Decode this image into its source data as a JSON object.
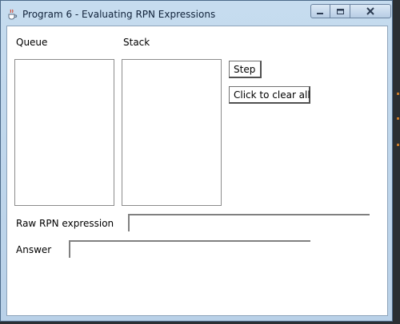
{
  "window": {
    "title": "Program 6 - Evaluating RPN Expressions"
  },
  "labels": {
    "queue": "Queue",
    "stack": "Stack",
    "raw_rpn": "Raw RPN expression",
    "answer": "Answer"
  },
  "buttons": {
    "step": "Step",
    "clear_all": "Click to clear all"
  },
  "fields": {
    "raw_rpn_value": "",
    "answer_value": ""
  },
  "lists": {
    "queue_items": [],
    "stack_items": []
  },
  "colors": {
    "titlebar": "#c6dcef",
    "client_bg": "#ffffff",
    "desktop": "#2a2f33"
  },
  "icons": {
    "app": "java-cup-icon",
    "minimize": "minimize-icon",
    "maximize": "maximize-icon",
    "close": "close-icon"
  }
}
